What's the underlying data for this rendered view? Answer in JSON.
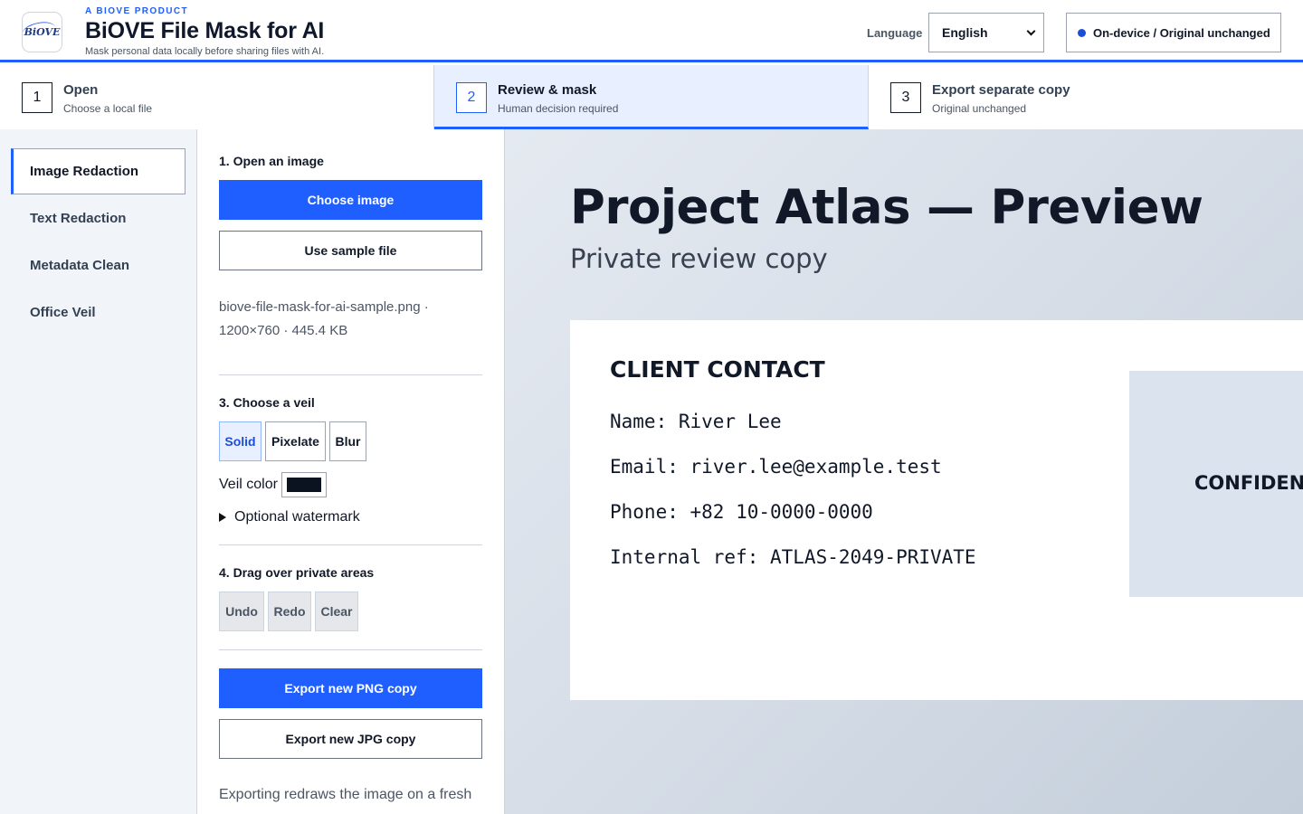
{
  "header": {
    "logo_text": "BiOVE",
    "overline": "A BIOVE PRODUCT",
    "title": "BiOVE File Mask for AI",
    "subtitle": "Mask personal data locally before sharing files with AI.",
    "language_label": "Language",
    "language_value": "English",
    "status_text": "On-device / Original unchanged",
    "accent_color": "#1f5eff"
  },
  "steps": [
    {
      "num": "1",
      "title": "Open",
      "subtitle": "Choose a local file",
      "active": false
    },
    {
      "num": "2",
      "title": "Review & mask",
      "subtitle": "Human decision required",
      "active": true
    },
    {
      "num": "3",
      "title": "Export separate copy",
      "subtitle": "Original unchanged",
      "active": false
    }
  ],
  "sidebar": {
    "items": [
      {
        "label": "Image Redaction",
        "active": true
      },
      {
        "label": "Text Redaction",
        "active": false
      },
      {
        "label": "Metadata Clean",
        "active": false
      },
      {
        "label": "Office Veil",
        "active": false
      }
    ]
  },
  "panel": {
    "open_title": "1. Open an image",
    "choose_image": "Choose image",
    "use_sample": "Use sample file",
    "file_info": "biove-file-mask-for-ai-sample.png · 1200×760 · 445.4 KB",
    "veil_title": "3. Choose a veil",
    "veil_options": [
      "Solid",
      "Pixelate",
      "Blur"
    ],
    "veil_selected": "Solid",
    "veil_color_label": "Veil color",
    "veil_color": "#0b1220",
    "watermark_label": "Optional watermark",
    "drag_title": "4. Drag over private areas",
    "undo": "Undo",
    "redo": "Redo",
    "clear": "Clear",
    "export_png": "Export new PNG copy",
    "export_jpg": "Export new JPG copy",
    "footnote": "Exporting redraws the image on a fresh"
  },
  "preview": {
    "title": "Project Atlas — Preview",
    "subtitle": "Private review copy",
    "card_heading": "CLIENT CONTACT",
    "lines": [
      "Name: River Lee",
      "Email: river.lee@example.test",
      "Phone: +82 10-0000-0000",
      "Internal ref: ATLAS-2049-PRIVATE"
    ],
    "stamp": "CONFIDENTIAL"
  }
}
